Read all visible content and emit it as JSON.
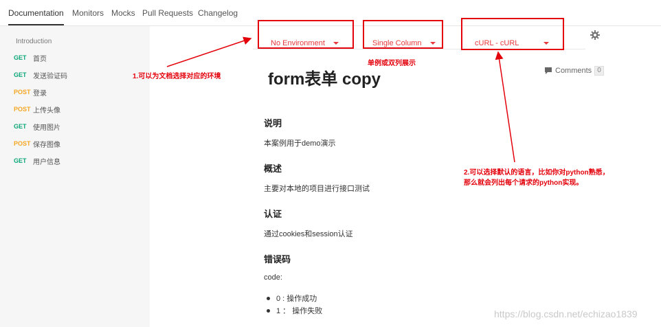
{
  "tabs": [
    "Documentation",
    "Monitors",
    "Mocks",
    "Pull Requests",
    "Changelog"
  ],
  "sidebar": {
    "intro": "Introduction",
    "items": [
      {
        "method": "GET",
        "label": "首页"
      },
      {
        "method": "GET",
        "label": "发送验证码"
      },
      {
        "method": "POST",
        "label": "登录"
      },
      {
        "method": "POST",
        "label": "上传头像"
      },
      {
        "method": "GET",
        "label": "使用图片"
      },
      {
        "method": "POST",
        "label": "保存图像"
      },
      {
        "method": "GET",
        "label": "用户信息"
      }
    ]
  },
  "controls": {
    "environment": "No Environment",
    "layout": "Single Column",
    "language": "cURL - cURL"
  },
  "doc": {
    "title": "form表单 copy",
    "comments_label": "Comments",
    "comments_count": "0",
    "sections": [
      {
        "title": "说明",
        "text": "本案例用于demo演示"
      },
      {
        "title": "概述",
        "text": "主要对本地的项目进行接口测试"
      },
      {
        "title": "认证",
        "text": "通过cookies和session认证"
      },
      {
        "title": "错误码",
        "text": "code:"
      }
    ],
    "bullets": [
      "0 : 操作成功",
      "1 ：  操作失败"
    ]
  },
  "annotations": {
    "a1": "1.可以为文档选择对应的环境",
    "a_layout": "单例或双列展示",
    "a2_line1": "2.可以选择默认的语言，比如你对python熟悉，",
    "a2_line2": "那么就会列出每个请求的python实现。"
  },
  "watermark": "https://blog.csdn.net/echizao1839",
  "colors": {
    "accent": "#e8383b",
    "annotation": "#e4000b",
    "get": "#0ca678",
    "post": "#f5a623"
  }
}
